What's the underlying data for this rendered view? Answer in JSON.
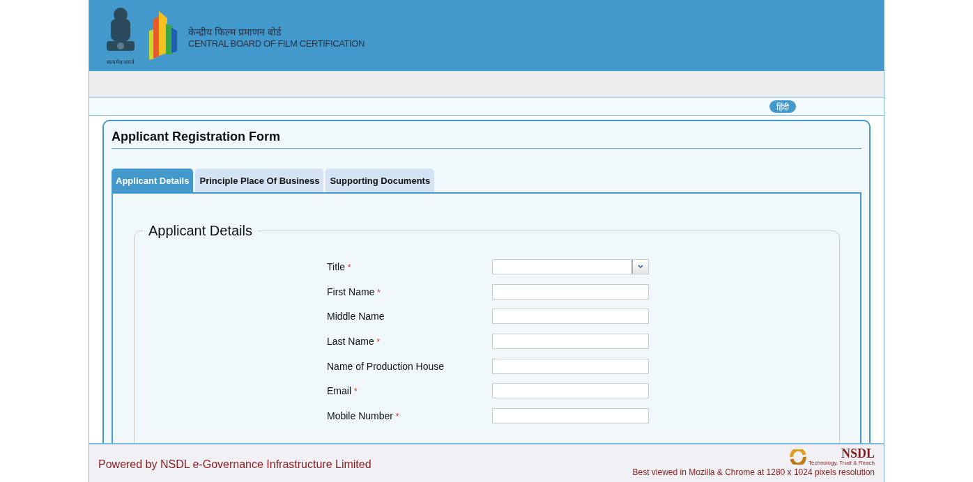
{
  "header": {
    "emblem_motto": "सत्यमेव जयते",
    "logo_hindi": "केन्द्रीय फिल्म प्रमाणन बोर्ड",
    "logo_english": "CENTRAL BOARD OF FILM CERTIFICATION"
  },
  "language_button": "हिंदी",
  "form": {
    "title": "Applicant Registration Form",
    "tabs": [
      {
        "label": "Applicant Details",
        "selected": true
      },
      {
        "label": "Principle Place Of Business",
        "selected": false
      },
      {
        "label": "Supporting Documents",
        "selected": false
      }
    ],
    "section_title": "Applicant Details",
    "fields": [
      {
        "label": "Title",
        "required": true,
        "kind": "select"
      },
      {
        "label": "First Name",
        "required": true,
        "kind": "text"
      },
      {
        "label": "Middle Name",
        "required": false,
        "kind": "text"
      },
      {
        "label": "Last Name",
        "required": true,
        "kind": "text"
      },
      {
        "label": "Name of Production House",
        "required": false,
        "kind": "text"
      },
      {
        "label": "Email",
        "required": true,
        "kind": "text"
      },
      {
        "label": "Mobile Number",
        "required": true,
        "kind": "text"
      }
    ],
    "required_mark": "*"
  },
  "footer": {
    "powered_by": "Powered by NSDL e-Governance Infrastructure Limited",
    "nsdl_name": "NSDL",
    "nsdl_tagline": "Technology, Trust & Reach",
    "best_viewed": "Best viewed in Mozilla & Chrome at 1280 x 1024 pixels resolution"
  }
}
